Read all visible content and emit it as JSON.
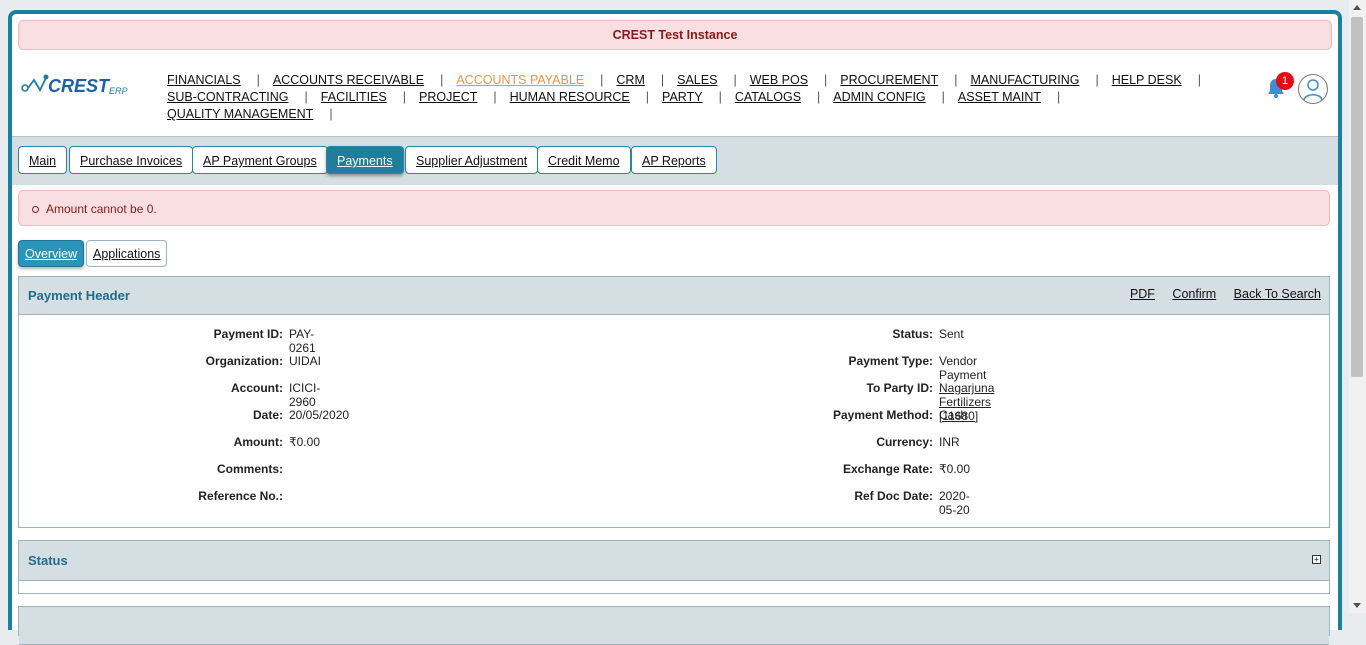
{
  "instance_banner": "CREST Test Instance",
  "logo_text": "CREST",
  "logo_sub": "ERP",
  "nav": {
    "row1": [
      "FINANCIALS",
      "ACCOUNTS RECEIVABLE",
      "ACCOUNTS PAYABLE",
      "CRM",
      "SALES",
      "WEB POS",
      "PROCUREMENT",
      "MANUFACTURING",
      "HELP DESK"
    ],
    "row2": [
      "SUB-CONTRACTING",
      "FACILITIES",
      "PROJECT",
      "HUMAN RESOURCE",
      "PARTY",
      "CATALOGS",
      "ADMIN CONFIG",
      "ASSET MAINT"
    ],
    "row3": [
      "QUALITY MANAGEMENT"
    ],
    "separator": "|"
  },
  "notification_count": "1",
  "tabs": [
    "Main",
    "Purchase Invoices",
    "AP Payment Groups",
    "Payments",
    "Supplier Adjustment",
    "Credit Memo",
    "AP Reports"
  ],
  "error_message": "Amount cannot be 0.",
  "subtabs": [
    "Overview",
    "Applications"
  ],
  "payment_header": {
    "title": "Payment Header",
    "links": [
      "PDF",
      "Confirm",
      "Back To Search"
    ],
    "left": [
      {
        "label": "Payment ID:",
        "value": "PAY-0261"
      },
      {
        "label": "Organization:",
        "value": "UIDAI"
      },
      {
        "label": "Account:",
        "value": "ICICI-2960"
      },
      {
        "label": "Date:",
        "value": "20/05/2020"
      },
      {
        "label": "Amount:",
        "value": "₹0.00"
      },
      {
        "label": "Comments:",
        "value": ""
      },
      {
        "label": "Reference No.:",
        "value": ""
      }
    ],
    "right": [
      {
        "label": "Status:",
        "value": "Sent"
      },
      {
        "label": "Payment Type:",
        "value": "Vendor Payment"
      },
      {
        "label": "To Party ID:",
        "value": "Nagarjuna Fertilizers [11680]"
      },
      {
        "label": "Payment Method:",
        "value": "Cash"
      },
      {
        "label": "Currency:",
        "value": "INR"
      },
      {
        "label": "Exchange Rate:",
        "value": "₹0.00"
      },
      {
        "label": "Ref Doc Date:",
        "value": "2020-05-20"
      }
    ]
  },
  "status_panel": {
    "title": "Status",
    "expander": "+"
  },
  "colors": {
    "accent": "#1f7e9d",
    "active_menu": "#f0934a",
    "error_bg": "#f9dfe1",
    "error_text": "#8b1a1a"
  }
}
